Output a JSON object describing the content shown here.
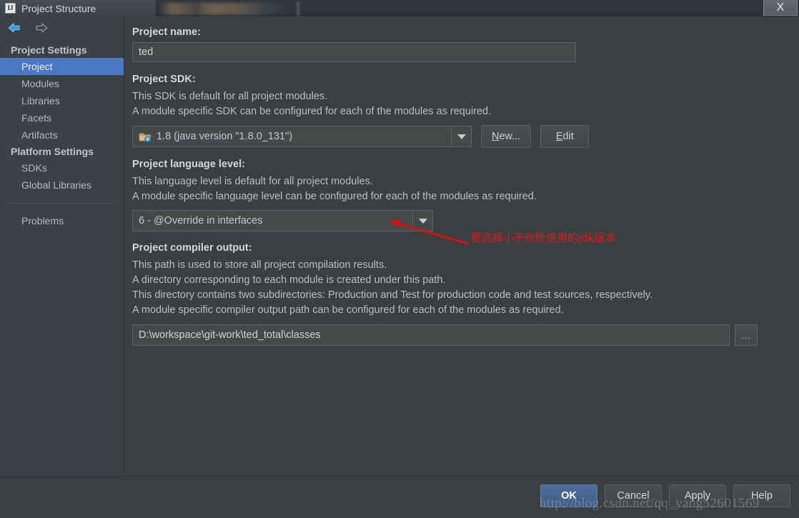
{
  "window": {
    "title": "Project Structure",
    "app_icon": "intellij-idea-icon",
    "close_label": "X"
  },
  "nav": {
    "back_icon": "arrow-left-icon",
    "forward_icon": "arrow-right-icon"
  },
  "sidebar": {
    "groups": [
      {
        "title": "Project Settings",
        "items": [
          {
            "label": "Project",
            "selected": true
          },
          {
            "label": "Modules",
            "selected": false
          },
          {
            "label": "Libraries",
            "selected": false
          },
          {
            "label": "Facets",
            "selected": false
          },
          {
            "label": "Artifacts",
            "selected": false
          }
        ]
      },
      {
        "title": "Platform Settings",
        "items": [
          {
            "label": "SDKs",
            "selected": false
          },
          {
            "label": "Global Libraries",
            "selected": false
          }
        ]
      }
    ],
    "extra": [
      {
        "label": "Problems",
        "selected": false
      }
    ]
  },
  "main": {
    "project_name": {
      "label": "Project name:",
      "value": "ted",
      "placeholder": "Project name"
    },
    "project_sdk": {
      "label": "Project SDK:",
      "desc1": "This SDK is default for all project modules.",
      "desc2": "A module specific SDK can be configured for each of the modules as required.",
      "selected": "1.8 (java version \"1.8.0_131\")",
      "icon": "java-sdk-folder-icon",
      "dropdown_icon": "chevron-down-icon",
      "new_button": "New...",
      "new_button_mnemonic": "N",
      "new_button_rest": "ew...",
      "edit_button": "Edit",
      "edit_button_mnemonic": "E",
      "edit_button_rest": "dit"
    },
    "language_level": {
      "label": "Project language level:",
      "desc1": "This language level is default for all project modules.",
      "desc2": "A module specific language level can be configured for each of the modules as required.",
      "selected": "6 - @Override in interfaces",
      "dropdown_icon": "chevron-down-icon"
    },
    "compiler_output": {
      "label": "Project compiler output:",
      "desc1": "This path is used to store all project compilation results.",
      "desc2": "A directory corresponding to each module is created under this path.",
      "desc3": "This directory contains two subdirectories: Production and Test for production code and test sources, respectively.",
      "desc4": "A module specific compiler output path can be configured for each of the modules as required.",
      "value": "D:\\workspace\\git-work\\ted_total\\classes",
      "browse_button": "..."
    }
  },
  "annotation": {
    "text": "要选择小于你所使用的jdk版本",
    "color": "#e01818",
    "arrow_icon": "red-arrow-icon"
  },
  "footer": {
    "buttons": [
      {
        "label": "OK",
        "primary": true
      },
      {
        "label": "Cancel",
        "primary": false
      },
      {
        "label": "Apply",
        "primary": false
      },
      {
        "label": "Help",
        "primary": false
      }
    ]
  },
  "watermark": {
    "text": "http://blog.csdn.net/qq_yang52601569"
  },
  "colors": {
    "window_bg": "#3c3f41",
    "sidebar_bg": "#3c4148",
    "selection_blue": "#4a77c4",
    "text_primary": "#d3d7da",
    "text_secondary": "#b9bec3",
    "annotation_red": "#e01818",
    "primary_button": "#4e6f9c"
  }
}
